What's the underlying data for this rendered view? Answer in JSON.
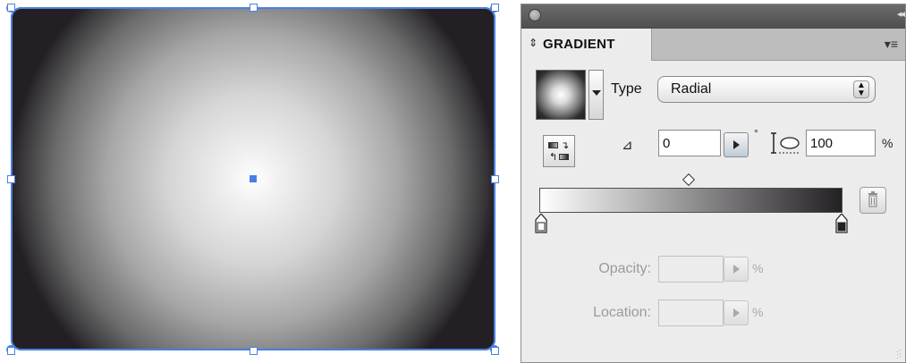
{
  "panel": {
    "tab_title": "GRADIENT",
    "tab_updown_glyph": "⇕",
    "collapse_glyph": "◂◂",
    "menu_glyph": "▾≡"
  },
  "gradient": {
    "type_label": "Type",
    "type_value": "Radial",
    "angle_value": "0",
    "degree_symbol": "°",
    "aspect_value": "100",
    "aspect_unit": "%",
    "opacity_label": "Opacity:",
    "opacity_unit": "%",
    "location_label": "Location:",
    "location_unit": "%",
    "stop_colors": [
      "#ffffff",
      "#241f24"
    ]
  },
  "icons": {
    "angle": "angle-icon",
    "aspect_ratio": "aspect-ratio-icon",
    "reverse": "reverse-gradient-icon",
    "trash": "trash-icon",
    "close": "close-icon"
  },
  "colors": {
    "selection": "#4a80e0",
    "panel_bg": "#ececec",
    "titlebar": "#5a5a5a",
    "gradient_dark": "#241f24"
  }
}
